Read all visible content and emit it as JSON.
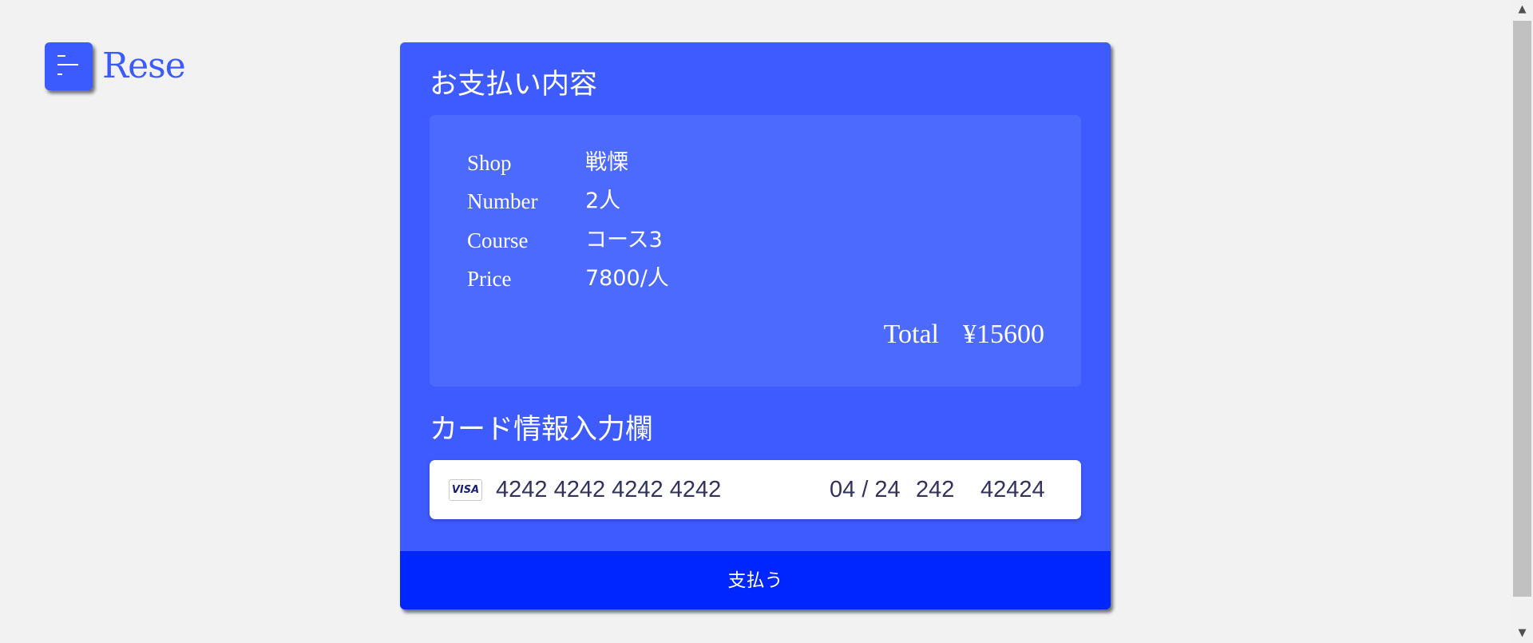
{
  "header": {
    "brand": "Rese",
    "menu_icon": "hamburger-menu-icon",
    "brand_color": "#3b5bff"
  },
  "payment": {
    "summary_title": "お支払い内容",
    "rows": [
      {
        "label": "Shop",
        "value": "戦慄"
      },
      {
        "label": "Number",
        "value": "2人"
      },
      {
        "label": "Course",
        "value": "コース3"
      },
      {
        "label": "Price",
        "value": "7800/人"
      }
    ],
    "total_label": "Total",
    "total_value": "¥15600",
    "card_title": "カード情報入力欄",
    "card": {
      "brand_icon": "visa-icon",
      "brand_text": "VISA",
      "number": "4242 4242 4242 4242",
      "expiry": "04 / 24",
      "cvc": "242",
      "zip": "42424"
    },
    "pay_button": "支払う",
    "colors": {
      "card_bg": "#3e5bff",
      "summary_bg": "#4d6aff",
      "button_bg": "#0026ff"
    }
  },
  "scrollbar": {
    "up_icon": "scroll-up-arrow-icon",
    "down_icon": "scroll-down-arrow-icon"
  }
}
